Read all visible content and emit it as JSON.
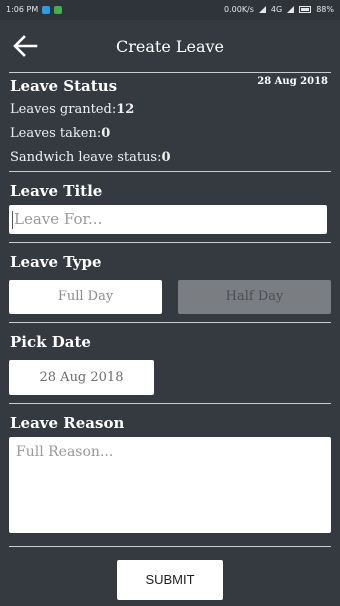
{
  "statusbar": {
    "time": "1:06 PM",
    "net_speed": "0.00K/s",
    "network": "4G",
    "battery": "88%"
  },
  "appbar": {
    "title": "Create Leave",
    "back_icon": "arrow-left-icon"
  },
  "leave_status": {
    "heading": "Leave Status",
    "date": "28 Aug 2018",
    "granted_label": "Leaves granted:",
    "granted_value": "12",
    "taken_label": "Leaves taken:",
    "taken_value": "0",
    "sandwich_label": "Sandwich leave status:",
    "sandwich_value": "0"
  },
  "leave_title": {
    "heading": "Leave Title",
    "placeholder": "Leave For..."
  },
  "leave_type": {
    "heading": "Leave Type",
    "full_day": "Full Day",
    "half_day": "Half Day",
    "selected": "Full Day"
  },
  "pick_date": {
    "heading": "Pick Date",
    "value": "28 Aug 2018"
  },
  "leave_reason": {
    "heading": "Leave Reason",
    "placeholder": "Full Reason..."
  },
  "submit_label": "SUBMIT"
}
